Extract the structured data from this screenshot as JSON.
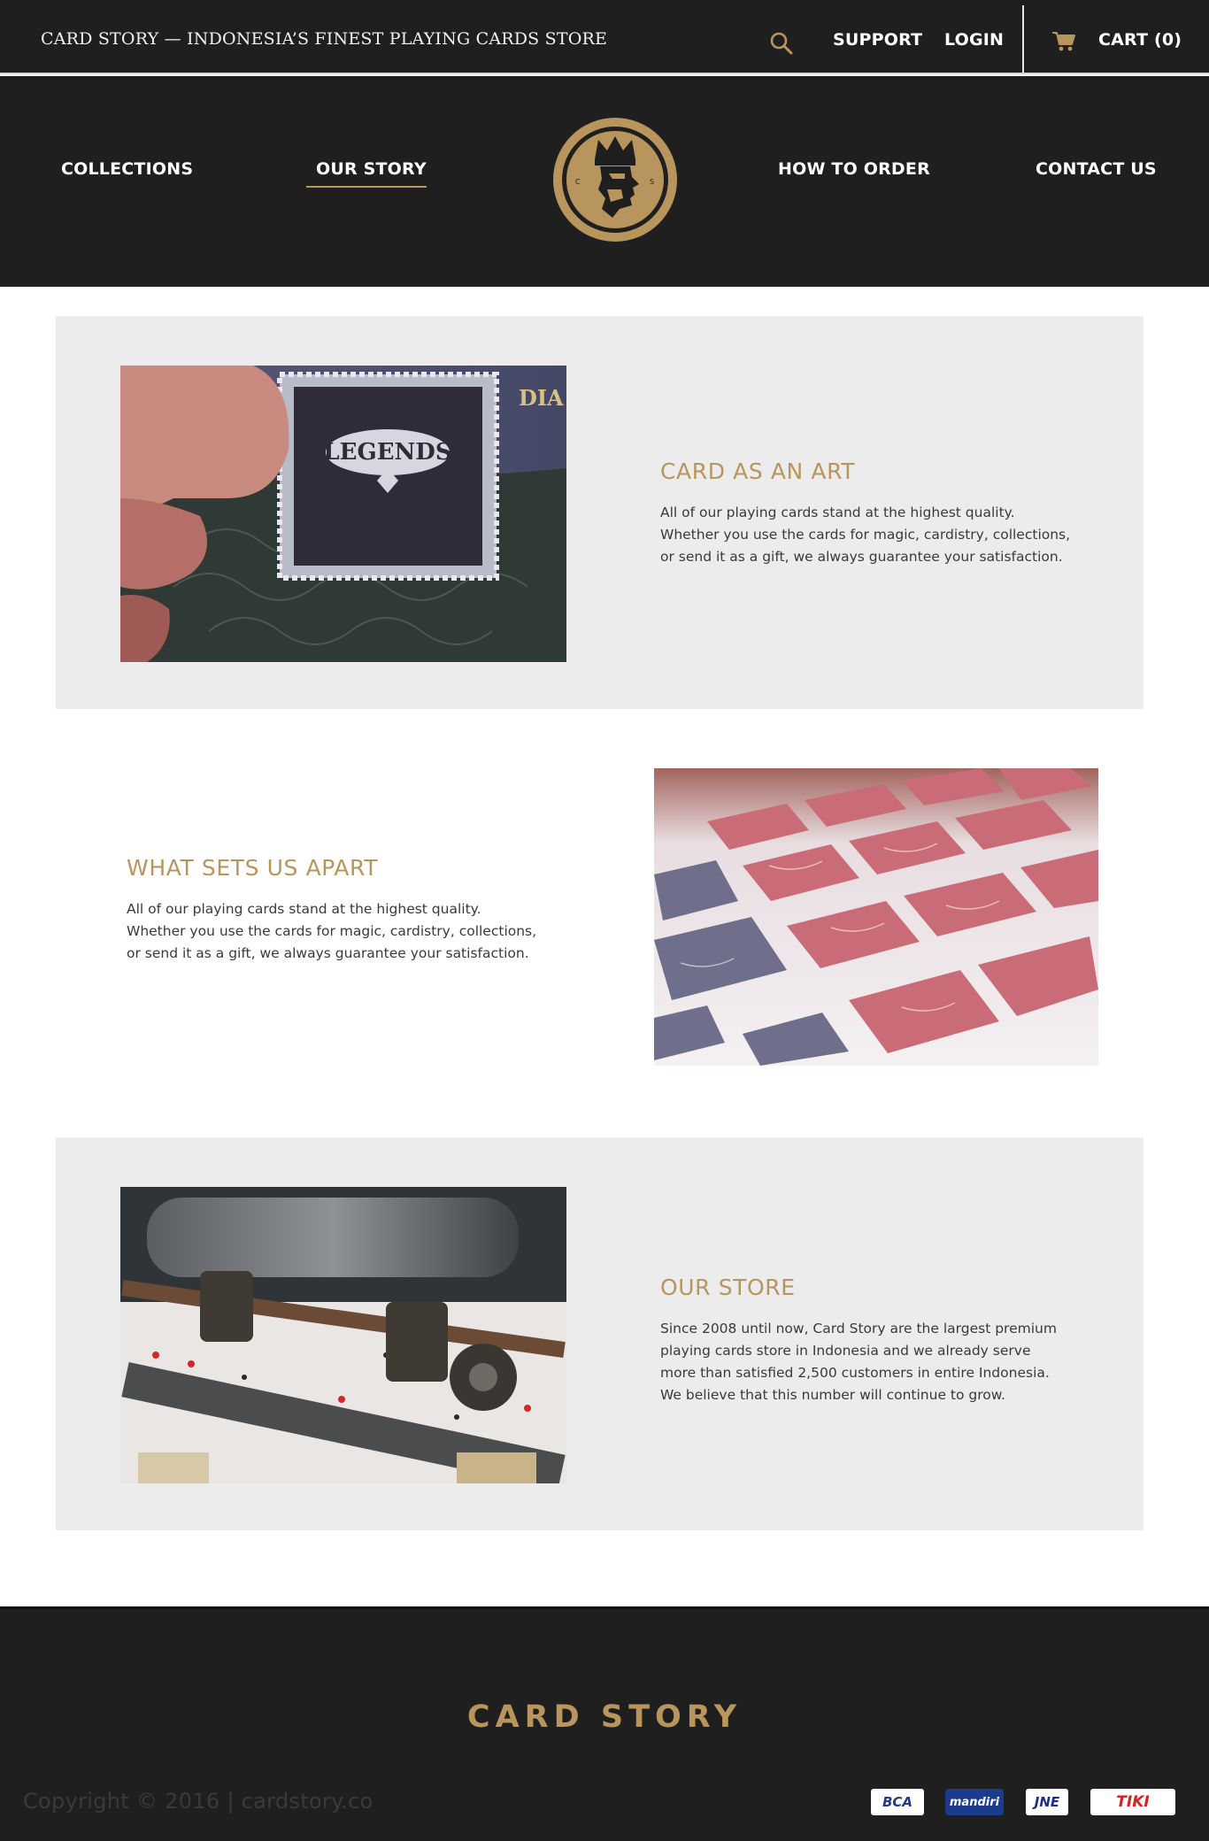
{
  "header": {
    "tagline": "CARD STORY — INDONESIA’S FINEST PLAYING CARDS STORE",
    "search_icon": "search-icon",
    "support_label": "SUPPORT",
    "login_label": "LOGIN",
    "cart_icon": "cart-icon",
    "cart_label": "CART (0)"
  },
  "nav": {
    "items": [
      {
        "label": "COLLECTIONS",
        "active": false
      },
      {
        "label": "OUR STORY",
        "active": true
      },
      {
        "label": "HOW TO ORDER",
        "active": false
      },
      {
        "label": "CONTACT US",
        "active": false
      }
    ],
    "logo": "card-story-king-logo"
  },
  "features": [
    {
      "heading": "CARD AS AN ART",
      "text": "All of our playing cards stand at the highest quality.\nWhether you use the cards for magic, cardistry, collections,\nor send it as a gift, we always guarantee your satisfaction.",
      "image": "legends-playing-card-box-photo",
      "photo_text": "DIA"
    },
    {
      "heading": "WHAT SETS US APART",
      "text": "All of our playing cards stand at the highest quality.\nWhether you use the cards for magic, cardistry, collections,\nor send it as a gift, we always guarantee your satisfaction.",
      "image": "uncut-card-sheet-photo"
    },
    {
      "heading": "OUR STORE",
      "text": "Since 2008 until now, Card Story are the largest premium\nplaying cards store in Indonesia and we already serve\nmore than satisfied 2,500 customers in entire Indonesia.\nWe believe that this number will continue to grow.",
      "image": "card-printing-machine-photo"
    }
  ],
  "footer": {
    "brand": "CARD STORY",
    "copyright": "Copyright © 2016 | cardstory.co",
    "payment_logos": [
      "BCA",
      "mandiri",
      "JNE",
      "TIKI"
    ]
  },
  "colors": {
    "dark": "#1f1f1f",
    "gold": "#b8955c",
    "panel_grey": "#ececec"
  }
}
